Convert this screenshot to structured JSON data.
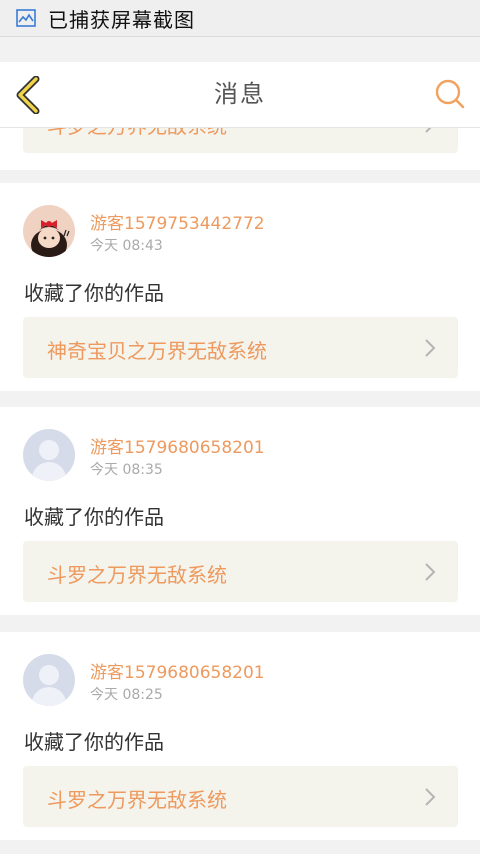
{
  "status_bar": {
    "icon": "screenshot-icon",
    "text": "已捕获屏幕截图"
  },
  "header": {
    "back_icon": "chevron-left-icon",
    "title": "消息",
    "search_icon": "search-icon"
  },
  "partial_card": {
    "work_title": "斗罗之万界无敌系统"
  },
  "messages": [
    {
      "user": "游客1579753442772",
      "time": "今天 08:43",
      "action": "收藏了你的作品",
      "work_title": "神奇宝贝之万界无敌系统",
      "avatar": "cartoon-girl-avatar"
    },
    {
      "user": "游客1579680658201",
      "time": "今天 08:35",
      "action": "收藏了你的作品",
      "work_title": "斗罗之万界无敌系统",
      "avatar": "default-user-avatar"
    },
    {
      "user": "游客1579680658201",
      "time": "今天 08:25",
      "action": "收藏了你的作品",
      "work_title": "斗罗之万界无敌系统",
      "avatar": "default-user-avatar"
    }
  ],
  "colors": {
    "accent": "#ee9a5e",
    "back_icon_stroke": "#f0d44a",
    "work_bg": "#f4f3ec",
    "page_bg": "#f2f2f2"
  }
}
